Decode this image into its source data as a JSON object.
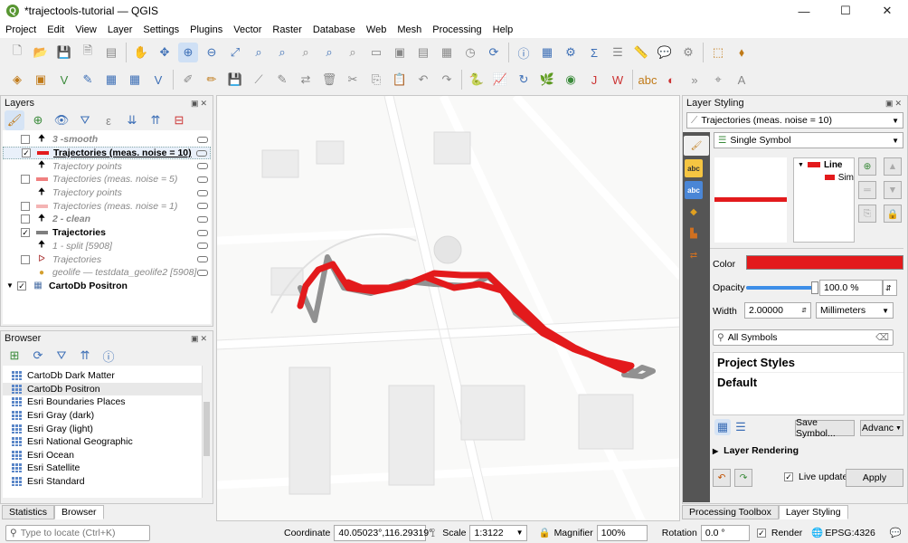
{
  "window": {
    "title": "*trajectools-tutorial — QGIS",
    "minimize": "—",
    "maximize": "☐",
    "close": "✕"
  },
  "menu": [
    "Project",
    "Edit",
    "View",
    "Layer",
    "Settings",
    "Plugins",
    "Vector",
    "Raster",
    "Database",
    "Web",
    "Mesh",
    "Processing",
    "Help"
  ],
  "layers_panel": {
    "title": "Layers",
    "items": [
      {
        "label": "3 -smooth",
        "checked": false,
        "style": "dim-bold"
      },
      {
        "label": "Trajectories (meas. noise = 10)",
        "checked": true,
        "style": "bold-underline",
        "symbol_color": "#e31a1c"
      },
      {
        "label": "Trajectory points",
        "checked": false,
        "style": "dim"
      },
      {
        "label": "Trajectories (meas. noise = 5)",
        "checked": false,
        "style": "dim",
        "symbol_color": "#f08080"
      },
      {
        "label": "Trajectory points",
        "checked": false,
        "style": "dim"
      },
      {
        "label": "Trajectories (meas. noise = 1)",
        "checked": false,
        "style": "dim",
        "symbol_color": "#f4b4b4"
      },
      {
        "label": "2 - clean",
        "checked": false,
        "style": "dim-bold"
      },
      {
        "label": "Trajectories",
        "checked": true,
        "style": "bold",
        "symbol_color": "#7f7f7f"
      },
      {
        "label": "1 - split [5908]",
        "checked": false,
        "style": "dim"
      },
      {
        "label": "Trajectories",
        "checked": false,
        "style": "dim"
      },
      {
        "label": "geolife — testdata_geolife2 [5908]",
        "checked": false,
        "style": "dim"
      },
      {
        "label": "CartoDb Positron",
        "checked": true,
        "style": "bold"
      }
    ]
  },
  "browser_panel": {
    "title": "Browser",
    "items": [
      "CartoDb Dark Matter",
      "CartoDb Positron",
      "Esri Boundaries Places",
      "Esri Gray (dark)",
      "Esri Gray (light)",
      "Esri National Geographic",
      "Esri Ocean",
      "Esri Satellite",
      "Esri Standard"
    ],
    "selected": "CartoDb Positron"
  },
  "bottom_tabs": {
    "statistics": "Statistics",
    "browser": "Browser"
  },
  "styling_panel": {
    "title": "Layer Styling",
    "layer_select": "Trajectories (meas. noise = 10)",
    "renderer": "Single Symbol",
    "tree_root": "Line",
    "tree_child": "Sim",
    "color_label": "Color",
    "color_value": "#e31a1c",
    "opacity_label": "Opacity",
    "opacity_value": "100.0 %",
    "opacity_fraction": 1.0,
    "width_label": "Width",
    "width_value": "2.00000",
    "width_unit": "Millimeters",
    "search_placeholder": "All Symbols",
    "styles": [
      "Project Styles",
      "Default"
    ],
    "save_symbol": "Save Symbol...",
    "advanced": "Advanc",
    "layer_rendering": "Layer Rendering",
    "live_update": "Live update",
    "apply": "Apply"
  },
  "right_tabs": {
    "processing": "Processing Toolbox",
    "styling": "Layer Styling"
  },
  "statusbar": {
    "locate_placeholder": "Type to locate (Ctrl+K)",
    "coordinate_label": "Coordinate",
    "coordinate_value": "40.05023°,116.29319°",
    "scale_label": "Scale",
    "scale_value": "1:3122",
    "magnifier_label": "Magnifier",
    "magnifier_value": "100%",
    "rotation_label": "Rotation",
    "rotation_value": "0.0 °",
    "render_label": "Render",
    "crs": "EPSG:4326"
  }
}
